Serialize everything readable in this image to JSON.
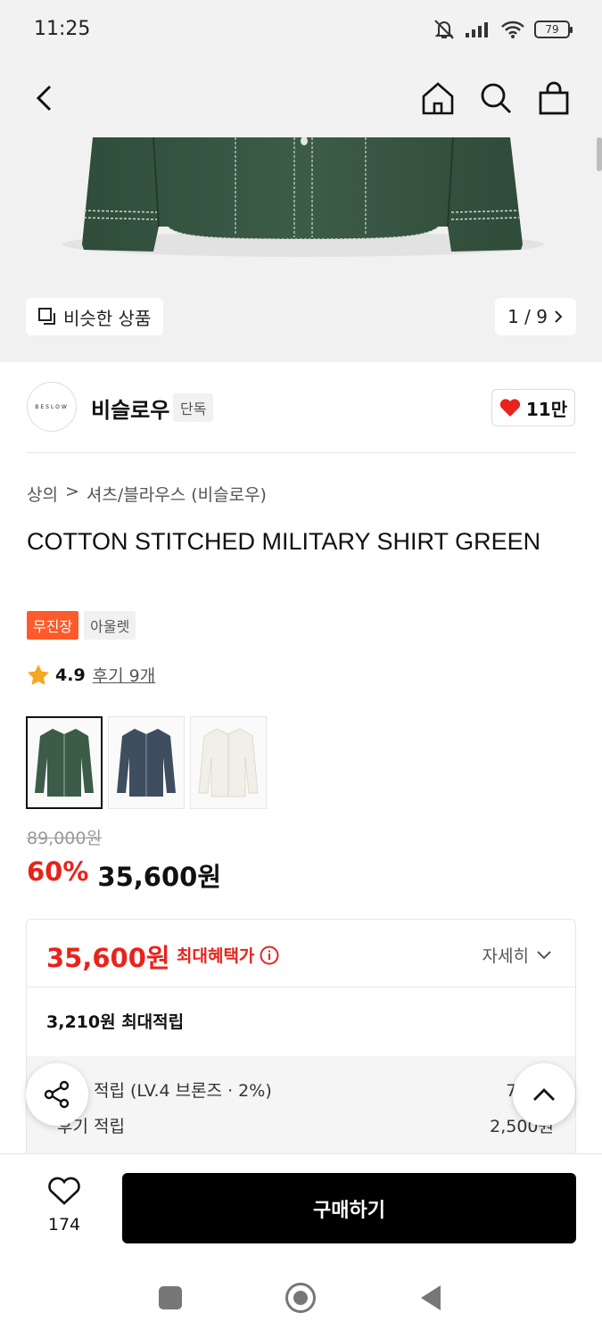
{
  "status_bar": {
    "time": "11:25",
    "battery": "79"
  },
  "hero": {
    "similar_label": "비슷한 상품",
    "pager": "1 / 9"
  },
  "brand": {
    "logo_text": "BESLOW",
    "name": "비슬로우",
    "tag": "단독",
    "likes": "11만"
  },
  "breadcrumb": {
    "category": "상의",
    "separator": ">",
    "subcategory": "셔츠/블라우스 (비슬로우)"
  },
  "product": {
    "title": "COTTON STITCHED MILITARY SHIRT GREEN",
    "badges": [
      "무진장",
      "아울렛"
    ],
    "rating": "4.9",
    "reviews": "후기 9개",
    "colors": [
      "green",
      "navy",
      "ivory"
    ],
    "original_price": "89,000원",
    "discount": "60%",
    "price": "35,600원"
  },
  "benefit": {
    "max_price": "35,600원",
    "max_label": "최대혜택가",
    "detail_label": "자세히",
    "max_points": "3,210원 최대적립",
    "lines": [
      {
        "label": "등급 적립 (LV.4 브론즈 · 2%)",
        "value": "710원"
      },
      {
        "label": "후기 적립",
        "value": "2,500원"
      }
    ]
  },
  "bottom": {
    "wish_count": "174",
    "buy_label": "구매하기"
  },
  "colors": {
    "accent_red": "#e8231c",
    "badge_orange": "#ff5a2a",
    "shirt_green": "#3d5c48"
  }
}
